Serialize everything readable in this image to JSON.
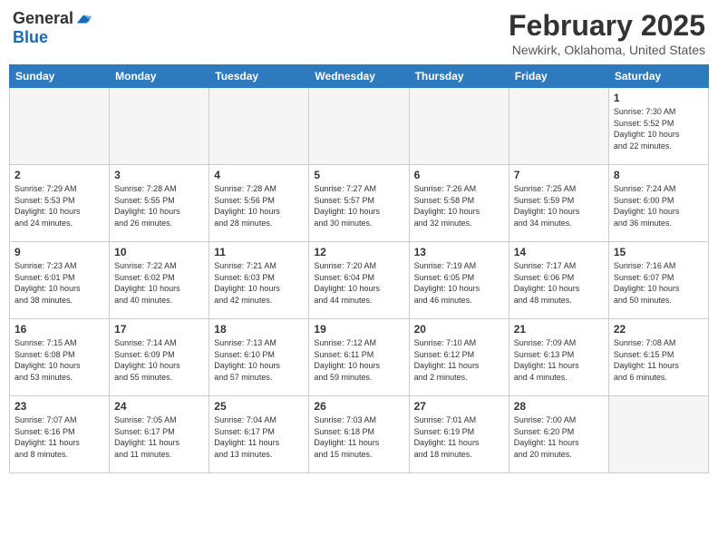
{
  "header": {
    "logo_general": "General",
    "logo_blue": "Blue",
    "month_title": "February 2025",
    "location": "Newkirk, Oklahoma, United States"
  },
  "days_of_week": [
    "Sunday",
    "Monday",
    "Tuesday",
    "Wednesday",
    "Thursday",
    "Friday",
    "Saturday"
  ],
  "weeks": [
    [
      {
        "day": "",
        "info": ""
      },
      {
        "day": "",
        "info": ""
      },
      {
        "day": "",
        "info": ""
      },
      {
        "day": "",
        "info": ""
      },
      {
        "day": "",
        "info": ""
      },
      {
        "day": "",
        "info": ""
      },
      {
        "day": "1",
        "info": "Sunrise: 7:30 AM\nSunset: 5:52 PM\nDaylight: 10 hours\nand 22 minutes."
      }
    ],
    [
      {
        "day": "2",
        "info": "Sunrise: 7:29 AM\nSunset: 5:53 PM\nDaylight: 10 hours\nand 24 minutes."
      },
      {
        "day": "3",
        "info": "Sunrise: 7:28 AM\nSunset: 5:55 PM\nDaylight: 10 hours\nand 26 minutes."
      },
      {
        "day": "4",
        "info": "Sunrise: 7:28 AM\nSunset: 5:56 PM\nDaylight: 10 hours\nand 28 minutes."
      },
      {
        "day": "5",
        "info": "Sunrise: 7:27 AM\nSunset: 5:57 PM\nDaylight: 10 hours\nand 30 minutes."
      },
      {
        "day": "6",
        "info": "Sunrise: 7:26 AM\nSunset: 5:58 PM\nDaylight: 10 hours\nand 32 minutes."
      },
      {
        "day": "7",
        "info": "Sunrise: 7:25 AM\nSunset: 5:59 PM\nDaylight: 10 hours\nand 34 minutes."
      },
      {
        "day": "8",
        "info": "Sunrise: 7:24 AM\nSunset: 6:00 PM\nDaylight: 10 hours\nand 36 minutes."
      }
    ],
    [
      {
        "day": "9",
        "info": "Sunrise: 7:23 AM\nSunset: 6:01 PM\nDaylight: 10 hours\nand 38 minutes."
      },
      {
        "day": "10",
        "info": "Sunrise: 7:22 AM\nSunset: 6:02 PM\nDaylight: 10 hours\nand 40 minutes."
      },
      {
        "day": "11",
        "info": "Sunrise: 7:21 AM\nSunset: 6:03 PM\nDaylight: 10 hours\nand 42 minutes."
      },
      {
        "day": "12",
        "info": "Sunrise: 7:20 AM\nSunset: 6:04 PM\nDaylight: 10 hours\nand 44 minutes."
      },
      {
        "day": "13",
        "info": "Sunrise: 7:19 AM\nSunset: 6:05 PM\nDaylight: 10 hours\nand 46 minutes."
      },
      {
        "day": "14",
        "info": "Sunrise: 7:17 AM\nSunset: 6:06 PM\nDaylight: 10 hours\nand 48 minutes."
      },
      {
        "day": "15",
        "info": "Sunrise: 7:16 AM\nSunset: 6:07 PM\nDaylight: 10 hours\nand 50 minutes."
      }
    ],
    [
      {
        "day": "16",
        "info": "Sunrise: 7:15 AM\nSunset: 6:08 PM\nDaylight: 10 hours\nand 53 minutes."
      },
      {
        "day": "17",
        "info": "Sunrise: 7:14 AM\nSunset: 6:09 PM\nDaylight: 10 hours\nand 55 minutes."
      },
      {
        "day": "18",
        "info": "Sunrise: 7:13 AM\nSunset: 6:10 PM\nDaylight: 10 hours\nand 57 minutes."
      },
      {
        "day": "19",
        "info": "Sunrise: 7:12 AM\nSunset: 6:11 PM\nDaylight: 10 hours\nand 59 minutes."
      },
      {
        "day": "20",
        "info": "Sunrise: 7:10 AM\nSunset: 6:12 PM\nDaylight: 11 hours\nand 2 minutes."
      },
      {
        "day": "21",
        "info": "Sunrise: 7:09 AM\nSunset: 6:13 PM\nDaylight: 11 hours\nand 4 minutes."
      },
      {
        "day": "22",
        "info": "Sunrise: 7:08 AM\nSunset: 6:15 PM\nDaylight: 11 hours\nand 6 minutes."
      }
    ],
    [
      {
        "day": "23",
        "info": "Sunrise: 7:07 AM\nSunset: 6:16 PM\nDaylight: 11 hours\nand 8 minutes."
      },
      {
        "day": "24",
        "info": "Sunrise: 7:05 AM\nSunset: 6:17 PM\nDaylight: 11 hours\nand 11 minutes."
      },
      {
        "day": "25",
        "info": "Sunrise: 7:04 AM\nSunset: 6:17 PM\nDaylight: 11 hours\nand 13 minutes."
      },
      {
        "day": "26",
        "info": "Sunrise: 7:03 AM\nSunset: 6:18 PM\nDaylight: 11 hours\nand 15 minutes."
      },
      {
        "day": "27",
        "info": "Sunrise: 7:01 AM\nSunset: 6:19 PM\nDaylight: 11 hours\nand 18 minutes."
      },
      {
        "day": "28",
        "info": "Sunrise: 7:00 AM\nSunset: 6:20 PM\nDaylight: 11 hours\nand 20 minutes."
      },
      {
        "day": "",
        "info": ""
      }
    ]
  ]
}
